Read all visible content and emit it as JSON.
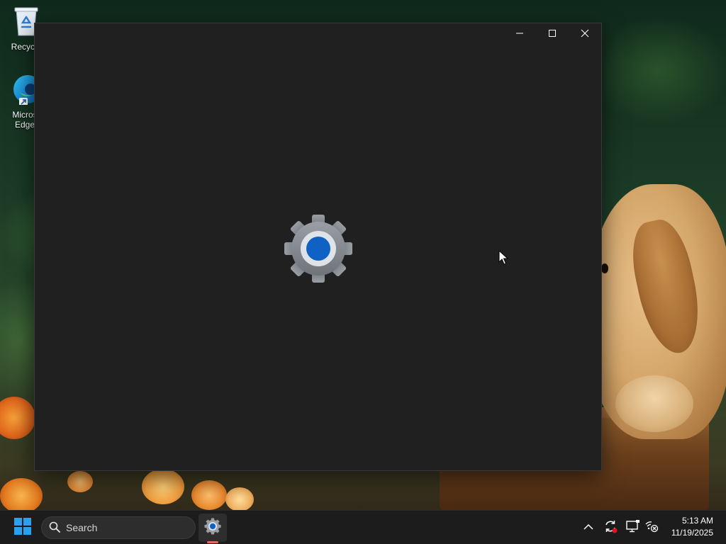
{
  "desktop": {
    "icons": [
      {
        "label": "Recycle",
        "icon": "recycle-bin-icon"
      },
      {
        "label": "Micros",
        "label2": "Edge",
        "icon": "edge-icon"
      }
    ]
  },
  "window": {
    "controls": {
      "minimize": "minimize-icon",
      "maximize": "maximize-icon",
      "close": "close-icon"
    },
    "splash_icon": "settings-gear-icon",
    "colors": {
      "background": "#202020",
      "gear": "#8a8d93",
      "gear_center": "#0f62c4"
    }
  },
  "taskbar": {
    "start_icon": "windows-start-icon",
    "search": {
      "placeholder": "Search"
    },
    "pinned_app": "settings-gear-icon",
    "tray": {
      "chevron": "chevron-up-icon",
      "update": "sync-icon",
      "display": "display-icon",
      "network": "network-disconnected-icon"
    },
    "clock": {
      "time": "5:13 AM",
      "date": "11/19/2025"
    },
    "colors": {
      "accent": "#e06a55"
    }
  }
}
